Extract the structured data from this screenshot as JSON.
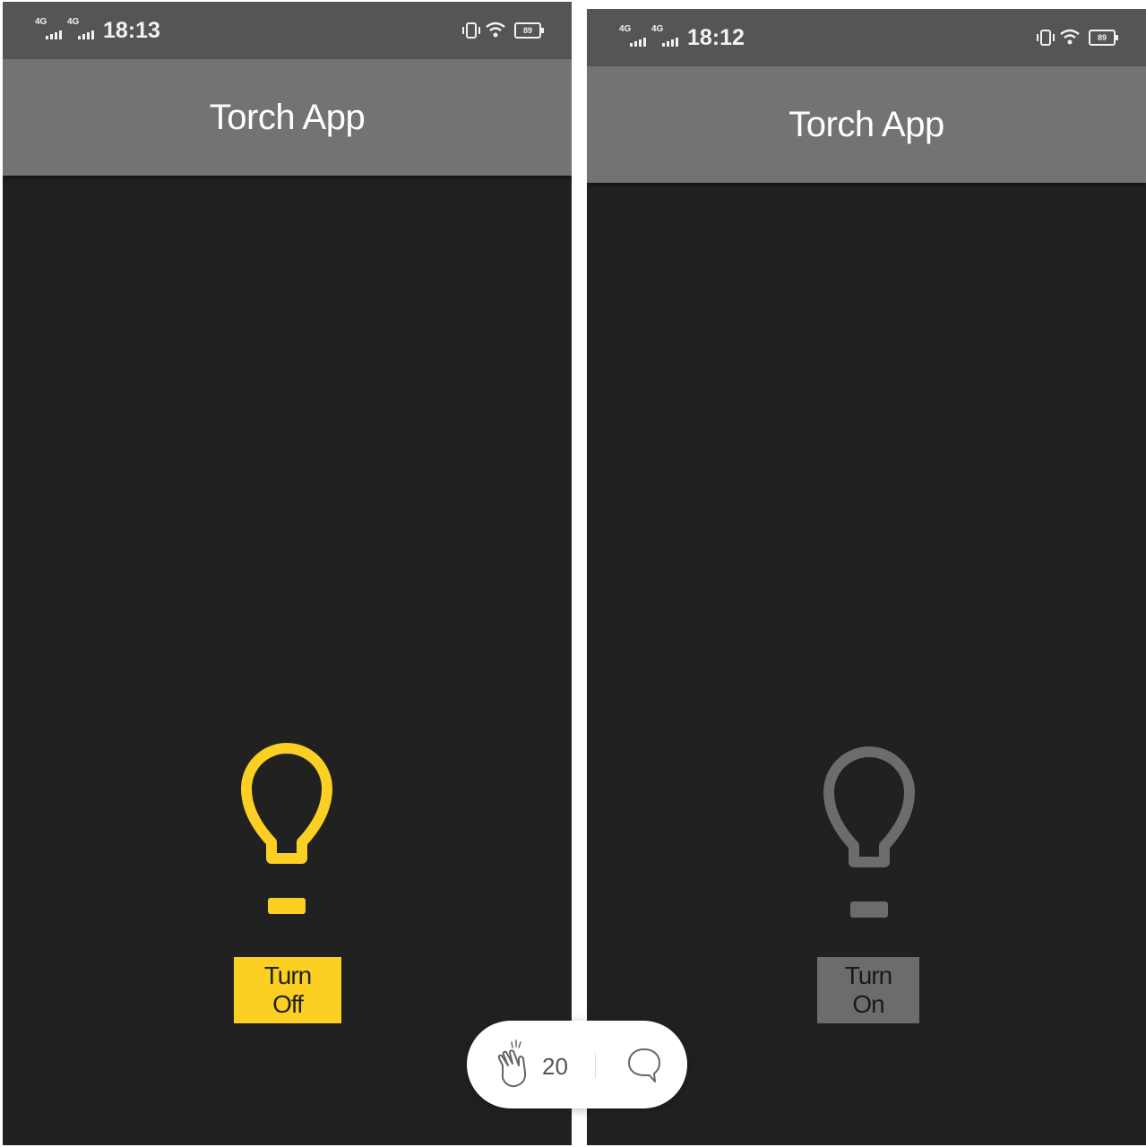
{
  "left_screen": {
    "status": {
      "network_1": "4G",
      "network_2": "4G",
      "time": "18:13",
      "battery": "89"
    },
    "app_title": "Torch App",
    "bulb_state": "on",
    "bulb_color": "#FBD022",
    "button_label": "Turn Off",
    "button_color": "#FBD022"
  },
  "right_screen": {
    "status": {
      "network_1": "4G",
      "network_2": "4G",
      "time": "18:12",
      "battery": "89"
    },
    "app_title": "Torch App",
    "bulb_state": "off",
    "bulb_color": "#6C6C6C",
    "button_label": "Turn On",
    "button_color": "#6C6C6C"
  },
  "reactions": {
    "clap_count": "20",
    "clap_icon": "clap-icon",
    "comment_icon": "comment-icon"
  }
}
